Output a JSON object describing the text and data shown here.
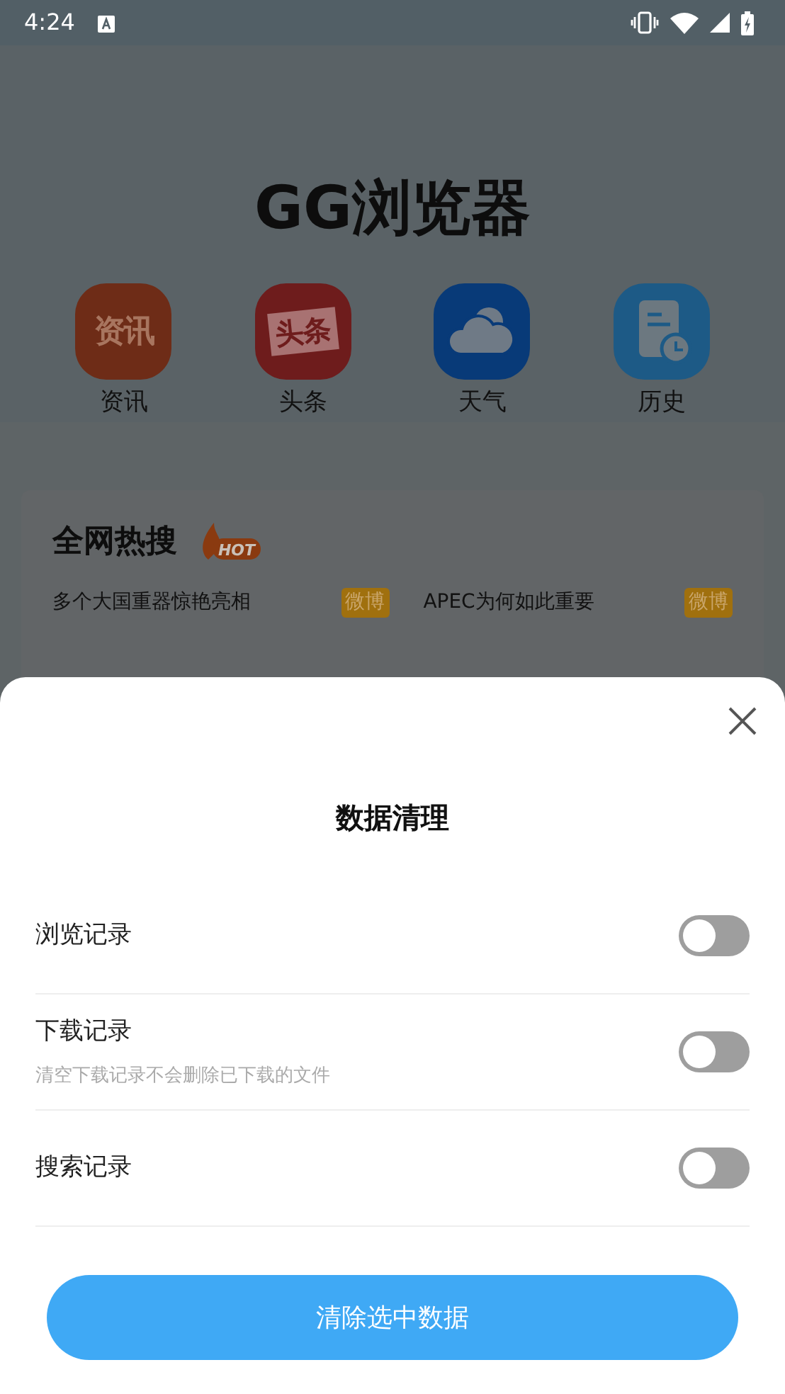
{
  "status_bar": {
    "time": "4:24"
  },
  "app_title": "GG浏览器",
  "shortcuts": [
    {
      "kind": "text-tile",
      "icon_text": "资讯",
      "label": "资讯",
      "color": "#6e2c17"
    },
    {
      "kind": "ticket-tile",
      "icon_text": "头条",
      "label": "头条",
      "color": "#6e1c1c"
    },
    {
      "kind": "weather-tile",
      "label": "天气",
      "color": "#083a78"
    },
    {
      "kind": "history-tile",
      "label": "历史",
      "color": "#1d5a86"
    }
  ],
  "hot_search": {
    "title": "全网热搜",
    "badge": "HOT",
    "items": [
      {
        "text": "多个大国重器惊艳亮相",
        "source": "微博"
      },
      {
        "text": "APEC为何如此重要",
        "source": "微博"
      }
    ]
  },
  "sheet": {
    "title": "数据清理",
    "options": [
      {
        "label": "浏览记录",
        "on": false
      },
      {
        "label": "下载记录",
        "hint": "清空下载记录不会删除已下载的文件",
        "on": false
      },
      {
        "label": "搜索记录",
        "on": false
      }
    ],
    "button": "清除选中数据"
  }
}
